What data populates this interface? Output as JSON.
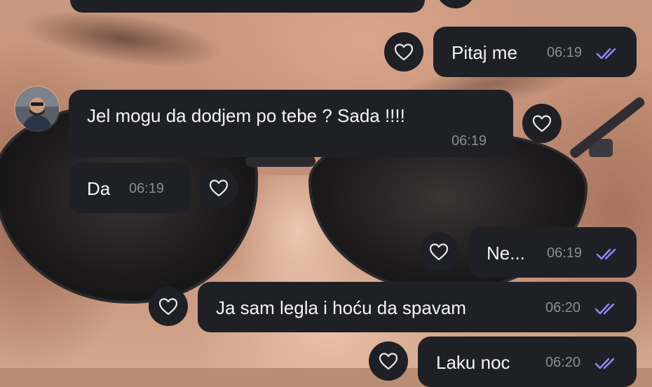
{
  "messages": [
    {
      "text": "Pitaj me",
      "time": "06:19",
      "direction": "outgoing",
      "status": "read"
    },
    {
      "text": "Jel mogu da dodjem po tebe ? Sada !!!!",
      "time": "06:19",
      "direction": "incoming"
    },
    {
      "text": "Da",
      "time": "06:19",
      "direction": "incoming"
    },
    {
      "text": "Ne...",
      "time": "06:19",
      "direction": "outgoing",
      "status": "read"
    },
    {
      "text": "Ja sam legla i hoću da spavam",
      "time": "06:20",
      "direction": "outgoing",
      "status": "read"
    },
    {
      "text": "Laku noc",
      "time": "06:20",
      "direction": "outgoing",
      "status": "read"
    }
  ],
  "icons": {
    "reaction": "heart-outline-icon",
    "read_receipt": "double-check-icon",
    "contact": "contact-avatar"
  },
  "colors": {
    "bubble": "#1f2025",
    "text": "#f4f4f6",
    "timestamp": "#8b8d94",
    "read_ticks": "#8f8cff"
  }
}
